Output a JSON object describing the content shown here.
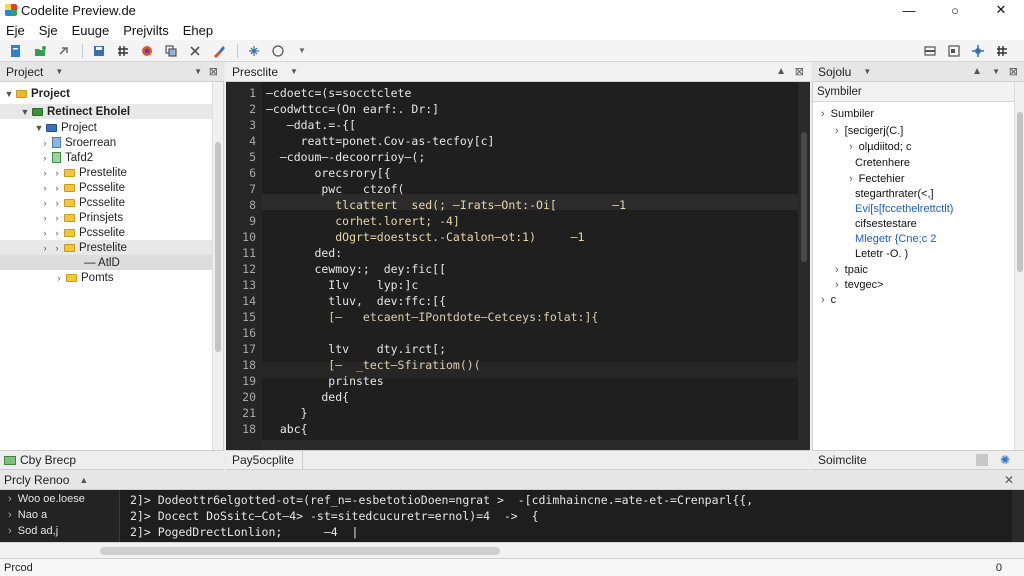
{
  "window": {
    "title": "Codelite Preview.de",
    "minimize": "—",
    "maximize": "○",
    "close": "✕"
  },
  "menu": [
    "Eje",
    "Sje",
    "Euuge",
    "Prejvilts",
    "Ehep"
  ],
  "project_panel": {
    "title": "Project",
    "items": [
      {
        "label": "Project",
        "depth": 0,
        "type": "root",
        "expanded": true
      },
      {
        "label": "Retinect Eholel",
        "depth": 1,
        "type": "folder",
        "expanded": true,
        "selected": true
      },
      {
        "label": "Project",
        "depth": 2,
        "type": "folder",
        "expanded": true
      },
      {
        "label": "Sroerrean",
        "depth": 3,
        "type": "file"
      },
      {
        "label": "Tafd2",
        "depth": 3,
        "type": "file"
      },
      {
        "label": "Prestelite",
        "depth": 3,
        "type": "folder"
      },
      {
        "label": "Pcsselite",
        "depth": 3,
        "type": "folder"
      },
      {
        "label": "Pcsselite",
        "depth": 3,
        "type": "folder"
      },
      {
        "label": "Prinsjets",
        "depth": 3,
        "type": "folder"
      },
      {
        "label": "Pcsselite",
        "depth": 3,
        "type": "folder"
      },
      {
        "label": "Prestelite",
        "depth": 3,
        "type": "folder",
        "selected": true
      },
      {
        "label": "— AtlD",
        "depth": 4,
        "type": "text",
        "selected": true
      },
      {
        "label": "Pomts",
        "depth": 3,
        "type": "folder"
      }
    ]
  },
  "editor": {
    "tab_title": "Presclite",
    "line_numbers": [
      "1",
      "2",
      "3",
      "4",
      "5",
      "6",
      "7",
      "8",
      "9",
      "10",
      "11",
      "12",
      "13",
      "14",
      "15",
      "16",
      "17",
      "18",
      "19",
      "20",
      "21",
      "18"
    ],
    "lines": [
      "—cdoetc=(s=socctclete",
      "—codwttcc=(On earf:. Dr:]",
      "   —ddat.=-{[",
      "     reatt=ponet.Cov-as-tecfoy[c]",
      "  —cdoum—-decoorrioy—(;",
      "       orecsrory[{",
      "        pwc   ctzof(",
      "          tlcattert  sed(; —Irats—Ont:-Oi[        —1",
      "          corhet.lorert; -4]",
      "          dOgrt=doestsct.-Catalon—ot:1)     —1",
      "       ded:",
      "       cewmoy:;  dey:fic[[",
      "         Ilv    lyp:]c",
      "         tluv,  dev:ffc:[{",
      "         [—   etcaent—IPontdote—Cetceys:folat:]{",
      "",
      "         ltv    dty.irct[;",
      "         [—  _tect—Sfiratiom()(",
      "         prinstes",
      "        ded{",
      "     }",
      "  abc{"
    ]
  },
  "symbol_panel": {
    "title": "Sojolu",
    "subtitle": "Symbiler",
    "items": [
      {
        "label": "Sumbiler",
        "depth": 0
      },
      {
        "label": "[secigerj(C.]",
        "depth": 1
      },
      {
        "label": "olµdiitod; c",
        "depth": 2
      },
      {
        "label": "Cretenhere",
        "depth": 2
      },
      {
        "label": "Fectehier",
        "depth": 2
      },
      {
        "label": "stegarthrater(<,]",
        "depth": 2
      },
      {
        "label": "Evi[s[fccethelrettctlt)",
        "depth": 2
      },
      {
        "label": "cifsestestare",
        "depth": 2
      },
      {
        "label": "Mlegetr {Cne;c 2",
        "depth": 2
      },
      {
        "label": "Letetr -O. )",
        "depth": 2
      },
      {
        "label": "tpaic",
        "depth": 1
      },
      {
        "label": "tevgec>",
        "depth": 1
      },
      {
        "label": "c",
        "depth": 0
      }
    ]
  },
  "tabs": {
    "left": "Cby Brecp",
    "center": "Pay5ocplite",
    "right": "Soimclite"
  },
  "bottom_panel": {
    "title": "Prcly Renoo",
    "left_items": [
      "Woo oe.loese",
      "Nao a",
      "Sod ad,j"
    ],
    "lines": [
      "2]> Dodeottr6elgotted-ot=(ref_n=-esbetotioDoen=ngrat >  -[cdimhaincne.=ate-et-=Crenparl{{,",
      "2]> Docect DoSsitc—Cot—4> -st=sitedcucuretr=ernol)=4  ->  {",
      "2]> PogedDrectLonlion;      —4  |"
    ]
  },
  "status": {
    "left": "Prcod",
    "right": "0"
  }
}
